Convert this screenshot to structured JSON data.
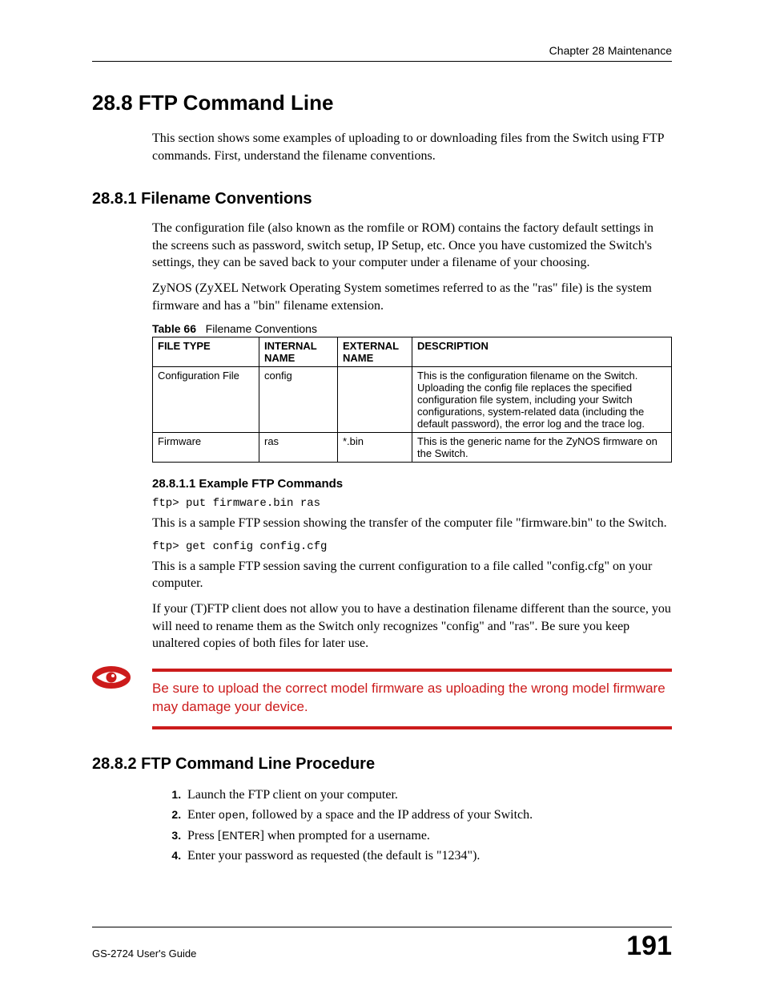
{
  "header": {
    "chapter": "Chapter 28 Maintenance"
  },
  "section": {
    "number_title": "28.8  FTP Command Line",
    "intro": "This section shows some examples of uploading to or downloading files from the Switch using FTP commands. First, understand the filename conventions."
  },
  "sub1": {
    "number_title": "28.8.1  Filename Conventions",
    "p1": "The configuration file (also known as the romfile or ROM) contains the factory default settings in the screens such as password, switch setup, IP Setup, etc. Once you have customized the Switch's settings, they can be saved back to your computer under a filename of your choosing.",
    "p2": "ZyNOS (ZyXEL Network Operating System sometimes referred to as the \"ras\" file) is the system firmware and has a \"bin\" filename extension."
  },
  "table": {
    "caption_label": "Table 66",
    "caption_text": "Filename Conventions",
    "headers": {
      "c1": "FILE TYPE",
      "c2": "INTERNAL NAME",
      "c3": "EXTERNAL NAME",
      "c4": "DESCRIPTION"
    },
    "rows": [
      {
        "c1": "Configuration File",
        "c2": "config",
        "c3": "",
        "c4": "This is the configuration filename on the Switch. Uploading the config file replaces the specified configuration file system, including your Switch configurations, system-related data (including the default password), the error log and the trace log."
      },
      {
        "c1": "Firmware",
        "c2": "ras",
        "c3": "*.bin",
        "c4": "This is the generic name for the ZyNOS firmware on the Switch."
      }
    ]
  },
  "subsub": {
    "number_title": "28.8.1.1  Example FTP Commands",
    "cmd1": "ftp> put firmware.bin ras",
    "p1": "This is a sample FTP session showing the transfer of the computer file \"firmware.bin\" to the Switch.",
    "cmd2": "ftp> get config config.cfg",
    "p2": "This is a sample FTP session saving the current configuration to a file called \"config.cfg\" on your computer.",
    "p3": "If your (T)FTP client does not allow you to have a destination filename different than the source, you will need to rename them as the Switch only recognizes \"config\" and \"ras\". Be sure you keep unaltered copies of both files for later use."
  },
  "warning": {
    "text": "Be sure to upload the correct model firmware as uploading the wrong model firmware may damage your device."
  },
  "sub2": {
    "number_title": "28.8.2  FTP Command Line Procedure",
    "steps": {
      "s1": "Launch the FTP client on your computer.",
      "s2_pre": "Enter ",
      "s2_cmd": "open",
      "s2_post": ", followed by a space and the IP address of your Switch.",
      "s3_pre": "Press [",
      "s3_key": "ENTER",
      "s3_post": "] when prompted for a username.",
      "s4": "Enter your password as requested (the default is \"1234\")."
    }
  },
  "footer": {
    "guide": "GS-2724 User's Guide",
    "page": "191"
  }
}
